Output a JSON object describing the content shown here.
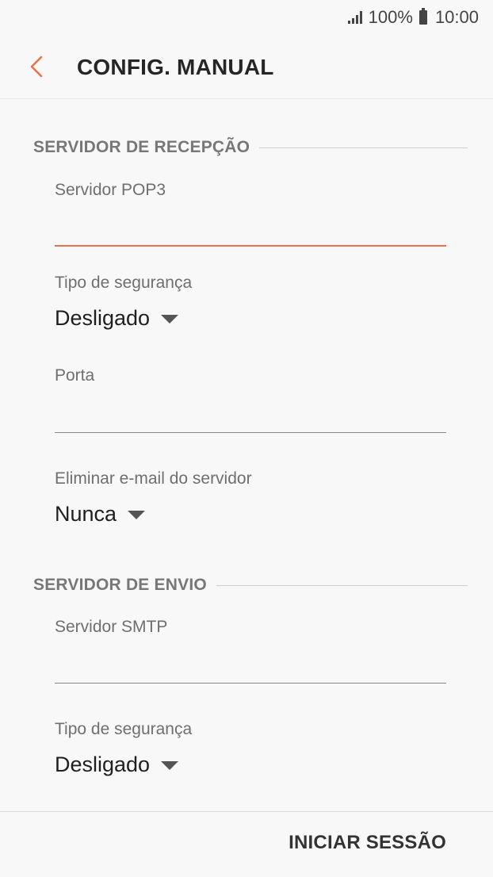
{
  "status_bar": {
    "battery": "100%",
    "time": "10:00"
  },
  "header": {
    "title": "CONFIG. MANUAL"
  },
  "incoming": {
    "section_title": "SERVIDOR DE RECEPÇÃO",
    "server_label": "Servidor POP3",
    "server_value": "",
    "security_label": "Tipo de segurança",
    "security_value": "Desligado",
    "port_label": "Porta",
    "port_value": "",
    "delete_label": "Eliminar e-mail do servidor",
    "delete_value": "Nunca"
  },
  "outgoing": {
    "section_title": "SERVIDOR DE ENVIO",
    "server_label": "Servidor SMTP",
    "server_value": "",
    "security_label": "Tipo de segurança",
    "security_value": "Desligado"
  },
  "footer": {
    "signin_label": "INICIAR SESSÃO"
  },
  "colors": {
    "accent": "#e8734a",
    "background": "#f8f8f8"
  }
}
